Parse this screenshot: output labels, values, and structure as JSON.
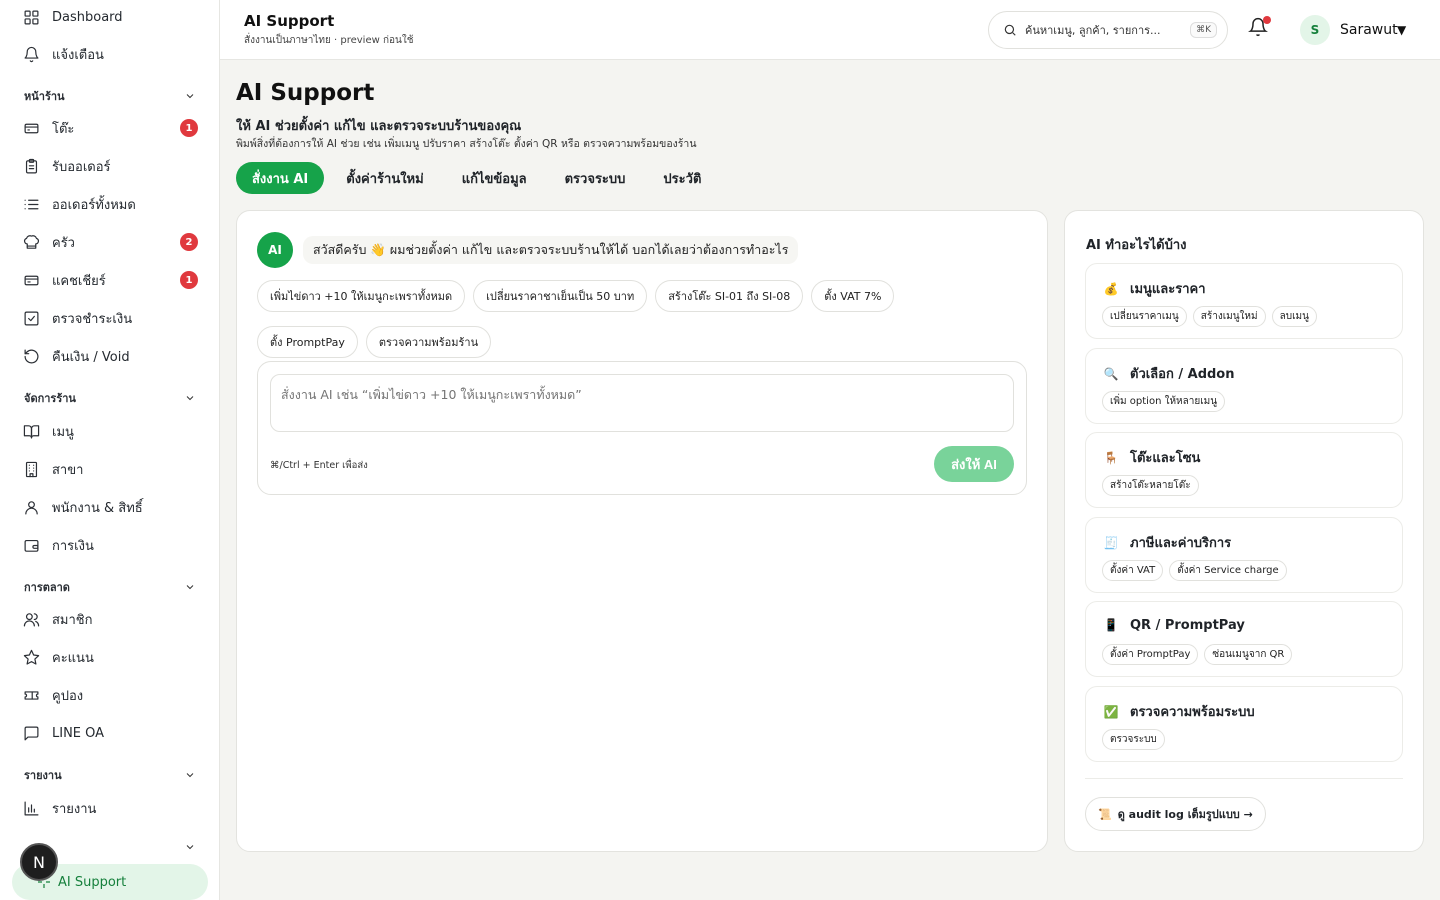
{
  "sidebar": {
    "top_items": [
      {
        "label": "Dashboard",
        "icon": "grid-icon"
      },
      {
        "label": "แจ้งเตือน",
        "icon": "bell-icon"
      }
    ],
    "sections": [
      {
        "title": "หน้าร้าน",
        "items": [
          {
            "label": "โต๊ะ",
            "icon": "table-icon",
            "badge": "1"
          },
          {
            "label": "รับออเดอร์",
            "icon": "clipboard-icon"
          },
          {
            "label": "ออเดอร์ทั้งหมด",
            "icon": "list-icon"
          },
          {
            "label": "ครัว",
            "icon": "chef-hat-icon",
            "badge": "2"
          },
          {
            "label": "แคชเชียร์",
            "icon": "cash-register-icon",
            "badge": "1"
          },
          {
            "label": "ตรวจชำระเงิน",
            "icon": "check-square-icon"
          },
          {
            "label": "คืนเงิน / Void",
            "icon": "refund-icon"
          }
        ]
      },
      {
        "title": "จัดการร้าน",
        "items": [
          {
            "label": "เมนู",
            "icon": "book-icon"
          },
          {
            "label": "สาขา",
            "icon": "building-icon"
          },
          {
            "label": "พนักงาน & สิทธิ์",
            "icon": "user-icon"
          },
          {
            "label": "การเงิน",
            "icon": "wallet-icon"
          }
        ]
      },
      {
        "title": "การตลาด",
        "items": [
          {
            "label": "สมาชิก",
            "icon": "users-icon"
          },
          {
            "label": "คะแนน",
            "icon": "star-icon"
          },
          {
            "label": "คูปอง",
            "icon": "ticket-icon"
          },
          {
            "label": "LINE OA",
            "icon": "chat-icon"
          }
        ]
      },
      {
        "title": "รายงาน",
        "items": [
          {
            "label": "รายงาน",
            "icon": "bar-chart-icon"
          }
        ]
      }
    ],
    "active_item": {
      "label": "AI Support",
      "icon": "sparkle-icon"
    },
    "floating_badge": "N"
  },
  "topbar": {
    "title": "AI Support",
    "subtitle": "สั่งงานเป็นภาษาไทย · preview ก่อนใช้",
    "search_placeholder": "ค้นหาเมนู, ลูกค้า, รายการ...",
    "search_shortcut": "⌘K",
    "user_initial": "S",
    "user_name": "Sarawut"
  },
  "page": {
    "title": "AI Support",
    "subtitle": "ให้ AI ช่วยตั้งค่า แก้ไข และตรวจระบบร้านของคุณ",
    "description": "พิมพ์สิ่งที่ต้องการให้ AI ช่วย เช่น เพิ่มเมนู ปรับราคา สร้างโต๊ะ ตั้งค่า QR หรือ ตรวจความพร้อมของร้าน"
  },
  "tabs": [
    {
      "label": "สั่งงาน AI",
      "active": true
    },
    {
      "label": "ตั้งค่าร้านใหม่",
      "active": false
    },
    {
      "label": "แก้ไขข้อมูล",
      "active": false
    },
    {
      "label": "ตรวจระบบ",
      "active": false
    },
    {
      "label": "ประวัติ",
      "active": false
    }
  ],
  "chat": {
    "avatar_label": "AI",
    "greeting": "สวัสดีครับ 👋 ผมช่วยตั้งค่า แก้ไข และตรวจระบบร้านให้ได้ บอกได้เลยว่าต้องการทำอะไร",
    "suggestions": [
      "เพิ่มไข่ดาว +10 ให้เมนูกะเพราทั้งหมด",
      "เปลี่ยนราคาชาเย็นเป็น 50 บาท",
      "สร้างโต๊ะ SI-01 ถึง SI-08",
      "ตั้ง VAT 7%",
      "ตั้ง PromptPay",
      "ตรวจความพร้อมร้าน"
    ],
    "input_placeholder": "สั่งงาน AI เช่น “เพิ่มไข่ดาว +10 ให้เมนูกะเพราทั้งหมด”",
    "hint": "⌘/Ctrl + Enter เพื่อส่ง",
    "send_label": "ส่งให้ AI"
  },
  "capabilities": {
    "title": "AI ทำอะไรได้บ้าง",
    "items": [
      {
        "title": "เมนูและราคา",
        "emoji": "💰",
        "tags": [
          "เปลี่ยนราคาเมนู",
          "สร้างเมนูใหม่",
          "ลบเมนู"
        ]
      },
      {
        "title": "ตัวเลือก / Addon",
        "emoji": "🔍",
        "tags": [
          "เพิ่ม option ให้หลายเมนู"
        ]
      },
      {
        "title": "โต๊ะและโซน",
        "emoji": "🪑",
        "tags": [
          "สร้างโต๊ะหลายโต๊ะ"
        ]
      },
      {
        "title": "ภาษีและค่าบริการ",
        "emoji": "🧾",
        "tags": [
          "ตั้งค่า VAT",
          "ตั้งค่า Service charge"
        ]
      },
      {
        "title": "QR / PromptPay",
        "emoji": "📱",
        "tags": [
          "ตั้งค่า PromptPay",
          "ซ่อนเมนูจาก QR"
        ]
      },
      {
        "title": "ตรวจความพร้อมระบบ",
        "emoji": "✅",
        "tags": [
          "ตรวจระบบ"
        ]
      }
    ],
    "audit_icon": "📜",
    "audit_label": "ดู audit log เต็มรูปแบบ →"
  },
  "colors": {
    "accent": "#16a34a",
    "accent_light": "#e3f5e8",
    "badge": "#e0393e",
    "background": "#f4f4f1"
  }
}
